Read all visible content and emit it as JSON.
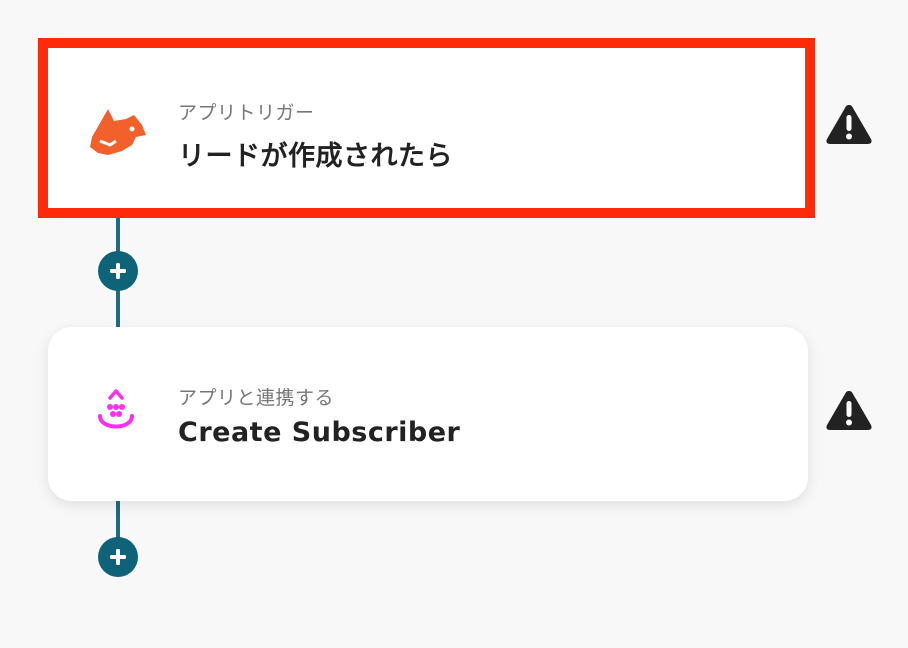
{
  "steps": [
    {
      "app_label": "アプリトリガー",
      "title": "リードが作成されたら",
      "icon": "fox-icon",
      "selected": true
    },
    {
      "app_label": "アプリと連携する",
      "title": "Create Subscriber",
      "icon": "drip-smile-icon",
      "selected": false
    }
  ],
  "add_step_symbol": "+",
  "colors": {
    "selected_border": "#ff2a0a",
    "connector": "#1e6a80",
    "add_button": "#0e6379",
    "trigger_icon": "#f2612c",
    "action_icon": "#ff2ef0",
    "warning": "#222222"
  }
}
